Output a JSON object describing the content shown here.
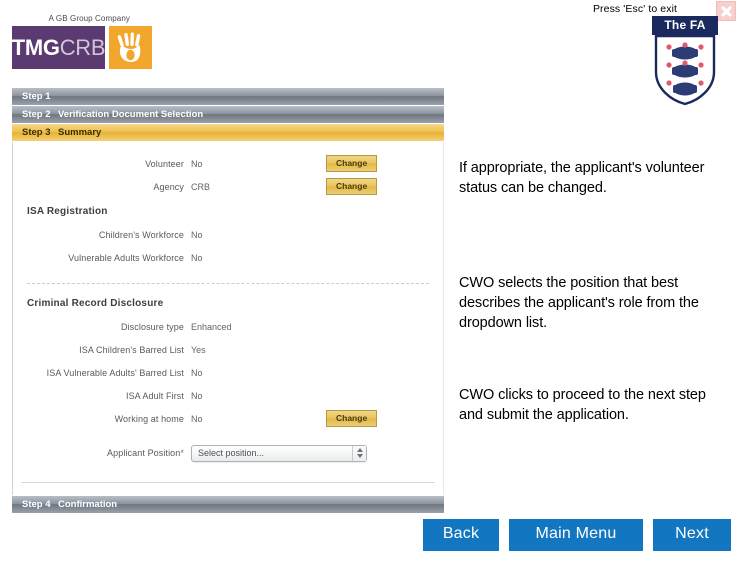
{
  "window": {
    "esc_hint": "Press 'Esc' to exit",
    "close_icon": "close-icon"
  },
  "fa_logo": {
    "banner_text": "The FA",
    "crest_icon": "fa-three-lions-crest-icon"
  },
  "brand": {
    "tagline": "A GB Group Company",
    "name_part1": "TMG",
    "name_part2": "CRB",
    "hand_icon": "hand-icon"
  },
  "steps": [
    {
      "num": "Step 1",
      "label": ""
    },
    {
      "num": "Step 2",
      "label": "Verification Document Selection"
    },
    {
      "num": "Step 3",
      "label": "Summary"
    },
    {
      "num": "Step 4",
      "label": "Confirmation"
    }
  ],
  "summary": {
    "top_rows": [
      {
        "label": "Volunteer",
        "value": "No",
        "action": "Change"
      },
      {
        "label": "Agency",
        "value": "CRB",
        "action": "Change"
      }
    ],
    "isa_heading": "ISA Registration",
    "isa_rows": [
      {
        "label": "Children's Workforce",
        "value": "No"
      },
      {
        "label": "Vulnerable Adults Workforce",
        "value": "No"
      }
    ],
    "crd_heading": "Criminal Record Disclosure",
    "crd_rows": [
      {
        "label": "Disclosure type",
        "value": "Enhanced"
      },
      {
        "label": "ISA Children's Barred List",
        "value": "Yes"
      },
      {
        "label": "ISA Vulnerable Adults' Barred List",
        "value": "No"
      },
      {
        "label": "ISA Adult First",
        "value": "No"
      },
      {
        "label": "Working at home",
        "value": "No",
        "action": "Change"
      }
    ],
    "position_label": "Applicant Position",
    "position_required": "*",
    "position_value": "Select position..."
  },
  "annotations": [
    "If appropriate, the applicant's volunteer status can be changed.",
    "CWO selects the position that best describes the applicant's role from the dropdown list.",
    "CWO clicks to proceed to the next step and submit the application."
  ],
  "nav": {
    "back": "Back",
    "main_menu": "Main Menu",
    "next": "Next"
  },
  "colors": {
    "accent_gold": "#e8b433",
    "nav_blue": "#1277c0",
    "brand_purple": "#5b3a72",
    "brand_orange": "#f2a62c",
    "fa_navy": "#1b2a5e"
  }
}
